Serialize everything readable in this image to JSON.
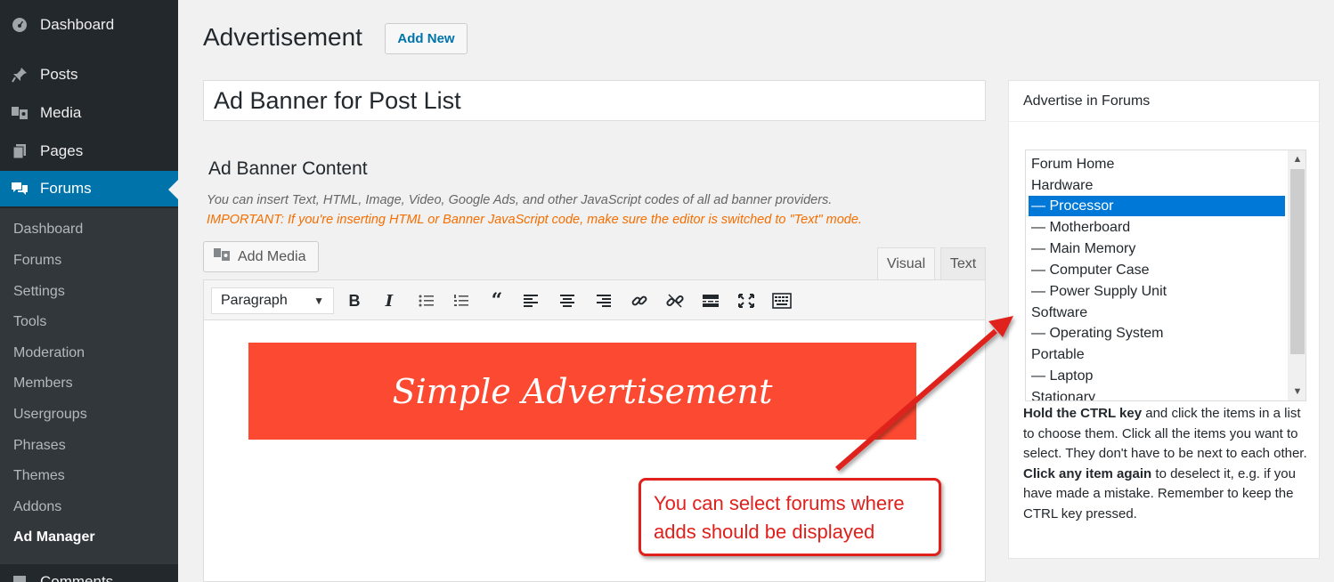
{
  "sidebar": {
    "top_items": [
      {
        "label": "Dashboard",
        "icon": "dashboard-icon"
      },
      {
        "label": "Posts",
        "icon": "pin-icon"
      },
      {
        "label": "Media",
        "icon": "media-icon"
      },
      {
        "label": "Pages",
        "icon": "pages-icon"
      },
      {
        "label": "Forums",
        "icon": "forums-icon"
      }
    ],
    "submenu": [
      "Dashboard",
      "Forums",
      "Settings",
      "Tools",
      "Moderation",
      "Members",
      "Usergroups",
      "Phrases",
      "Themes",
      "Addons",
      "Ad Manager"
    ],
    "bottom_item": {
      "label": "Comments",
      "icon": "comments-icon"
    }
  },
  "header": {
    "title": "Advertisement",
    "add_new": "Add New"
  },
  "post_title": "Ad Banner for Post List",
  "content": {
    "heading": "Ad Banner Content",
    "hint": "You can insert Text, HTML, Image, Video, Google Ads, and other JavaScript codes of all ad banner providers.",
    "important": "IMPORTANT: If you're inserting HTML or Banner JavaScript code, make sure the editor is switched to \"Text\" mode.",
    "add_media": "Add Media",
    "tabs": {
      "visual": "Visual",
      "text": "Text"
    },
    "format": "Paragraph",
    "banner_text": "Simple Advertisement"
  },
  "toolbar_icons": [
    "bold-icon",
    "italic-icon",
    "bullet-list-icon",
    "numbered-list-icon",
    "blockquote-icon",
    "align-left-icon",
    "align-center-icon",
    "align-right-icon",
    "link-icon",
    "unlink-icon",
    "read-more-icon",
    "fullscreen-icon",
    "toolbar-toggle-icon"
  ],
  "callout": {
    "line1": "You can select forums where",
    "line2": "adds should be displayed"
  },
  "side_box": {
    "title": "Advertise in Forums",
    "forums": [
      "Forum Home",
      "Hardware",
      "— Processor",
      "— Motherboard",
      "— Main Memory",
      "— Computer Case",
      "— Power Supply Unit",
      "Software",
      "— Operating System",
      "Portable",
      "— Laptop",
      "Stationary"
    ],
    "selected": "— Processor",
    "help": {
      "b1": "Hold the CTRL key",
      "t1": " and click the items in a list to choose them. Click all the items you want to select. They don't have to be next to each other.",
      "b2": "Click any item again",
      "t2": " to deselect it, e.g. if you have made a mistake. Remember to keep the CTRL key pressed."
    }
  },
  "colors": {
    "sidebar": "#23282d",
    "submenu": "#32373c",
    "active": "#0073aa",
    "banner": "#fc4931",
    "callout": "#e0201c",
    "selected": "#0078d7"
  }
}
